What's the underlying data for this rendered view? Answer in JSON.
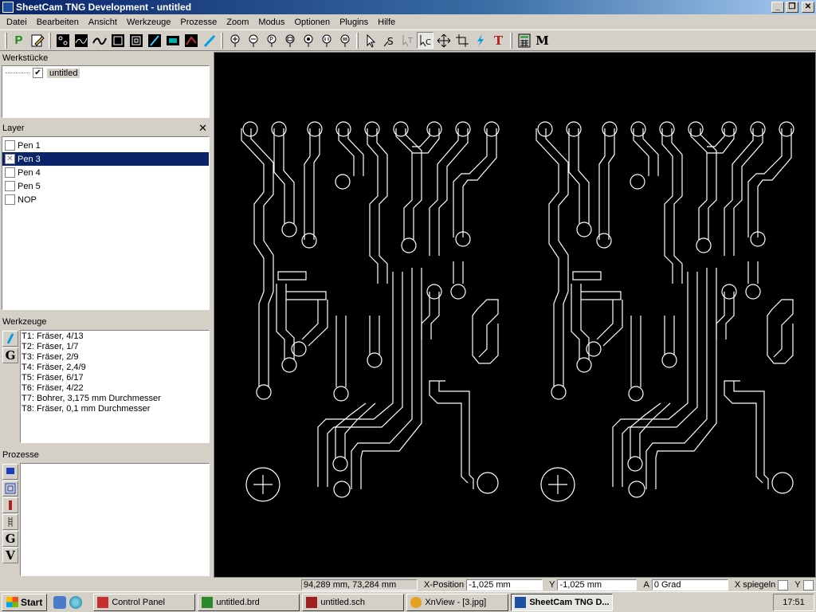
{
  "window": {
    "title": "SheetCam TNG Development - untitled"
  },
  "menu": [
    "Datei",
    "Bearbeiten",
    "Ansicht",
    "Werkzeuge",
    "Prozesse",
    "Zoom",
    "Modus",
    "Optionen",
    "Plugins",
    "Hilfe"
  ],
  "panels": {
    "workpieces": {
      "title": "Werkstücke",
      "item": "untitled",
      "checked": "✔"
    },
    "layers": {
      "title": "Layer",
      "close": "✕",
      "items": [
        {
          "label": "Pen 1",
          "mark": ""
        },
        {
          "label": "Pen 3",
          "mark": "✕"
        },
        {
          "label": "Pen 4",
          "mark": ""
        },
        {
          "label": "Pen 5",
          "mark": ""
        },
        {
          "label": "NOP",
          "mark": ""
        }
      ]
    },
    "tools": {
      "title": "Werkzeuge",
      "side_g": "G",
      "items": [
        "T1: Fräser, 4/13",
        "T2: Fräser, 1/7",
        "T3: Fräser, 2/9",
        "T4: Fräser, 2,4/9",
        "T5: Fräser, 6/17",
        "T6: Fräser, 4/22",
        "T7: Bohrer, 3,175 mm Durchmesser",
        "T8: Fräser, 0,1 mm Durchmesser"
      ]
    },
    "processes": {
      "title": "Prozesse",
      "side_g": "G",
      "side_v": "V"
    }
  },
  "toolbar": {
    "text_tool": "T",
    "macro_tool": "M",
    "p_tool": "P"
  },
  "status": {
    "coords": "94,289 mm, 73,284 mm",
    "x_label": "X-Position",
    "x_value": "-1,025 mm",
    "y_label": "Y",
    "y_value": "-1,025 mm",
    "a_label": "A",
    "a_value": "0 Grad",
    "mirror_x": "X spiegeln",
    "mirror_y": "Y"
  },
  "taskbar": {
    "start": "Start",
    "tasks": [
      "Control Panel",
      "untitled.brd",
      "untitled.sch",
      "XnView - [3.jpg]",
      "SheetCam TNG D..."
    ],
    "clock": "17:51"
  },
  "colors": {
    "canvas_bg": "#000000",
    "trace": "#ffffff",
    "selection": "#0a246a"
  }
}
